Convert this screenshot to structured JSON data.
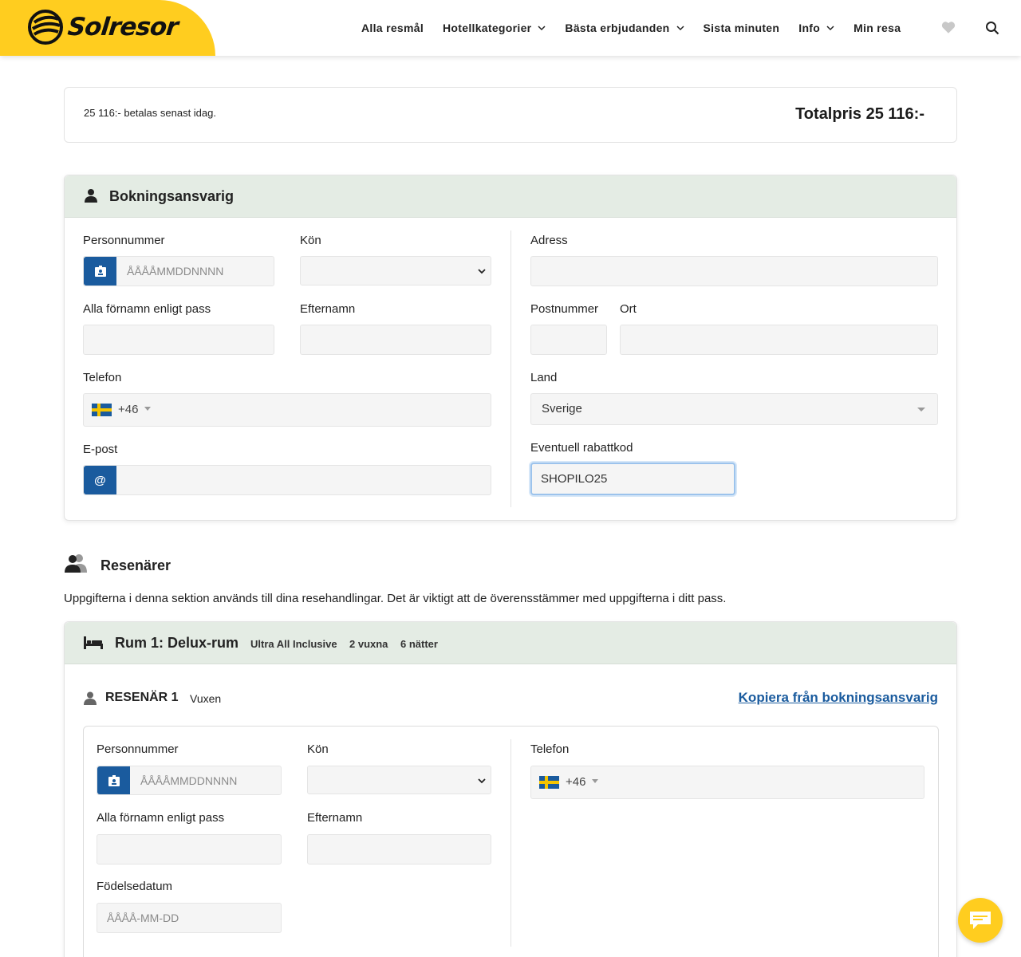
{
  "brand": {
    "name": "Solresor"
  },
  "nav": {
    "items": [
      {
        "label": "Alla resmål",
        "dropdown": false
      },
      {
        "label": "Hotellkategorier",
        "dropdown": true
      },
      {
        "label": "Bästa erbjudanden",
        "dropdown": true
      },
      {
        "label": "Sista minuten",
        "dropdown": false
      },
      {
        "label": "Info",
        "dropdown": true
      },
      {
        "label": "Min resa",
        "dropdown": false
      }
    ]
  },
  "price": {
    "note": "25 116:- betalas senast idag.",
    "total": "Totalpris 25 116:-"
  },
  "booker": {
    "title": "Bokningsansvarig",
    "personnummer_label": "Personnummer",
    "personnummer_placeholder": "ÅÅÅÅMMDDNNNN",
    "gender_label": "Kön",
    "firstnames_label": "Alla förnamn enligt pass",
    "lastname_label": "Efternamn",
    "phone_label": "Telefon",
    "phone_dial": "+46",
    "email_label": "E-post",
    "email_addon": "@",
    "address_label": "Adress",
    "zip_label": "Postnummer",
    "city_label": "Ort",
    "country_label": "Land",
    "country_value": "Sverige",
    "discount_label": "Eventuell rabattkod",
    "discount_value": "SHOPILO25"
  },
  "travellers": {
    "title": "Resenärer",
    "description": "Uppgifterna i denna sektion används till dina resehandlingar. Det är viktigt att de överensstämmer med uppgifterna i ditt pass.",
    "room": {
      "title": "Rum 1: Delux-rum",
      "board": "Ultra All Inclusive",
      "guests": "2 vuxna",
      "nights": "6 nätter"
    },
    "traveller1": {
      "title": "RESENÄR 1",
      "type": "Vuxen",
      "copy_link": "Kopiera från bokningsansvarig",
      "personnummer_label": "Personnummer",
      "personnummer_placeholder": "ÅÅÅÅMMDDNNNN",
      "gender_label": "Kön",
      "phone_label": "Telefon",
      "phone_dial": "+46",
      "firstnames_label": "Alla förnamn enligt pass",
      "lastname_label": "Efternamn",
      "birthdate_label": "Födelsedatum",
      "birthdate_placeholder": "ÅÅÅÅ-MM-DD"
    }
  },
  "colors": {
    "brand_yellow": "#ffcd1f",
    "accent_blue": "#1a5b9e",
    "header_green": "#e4ece4"
  }
}
